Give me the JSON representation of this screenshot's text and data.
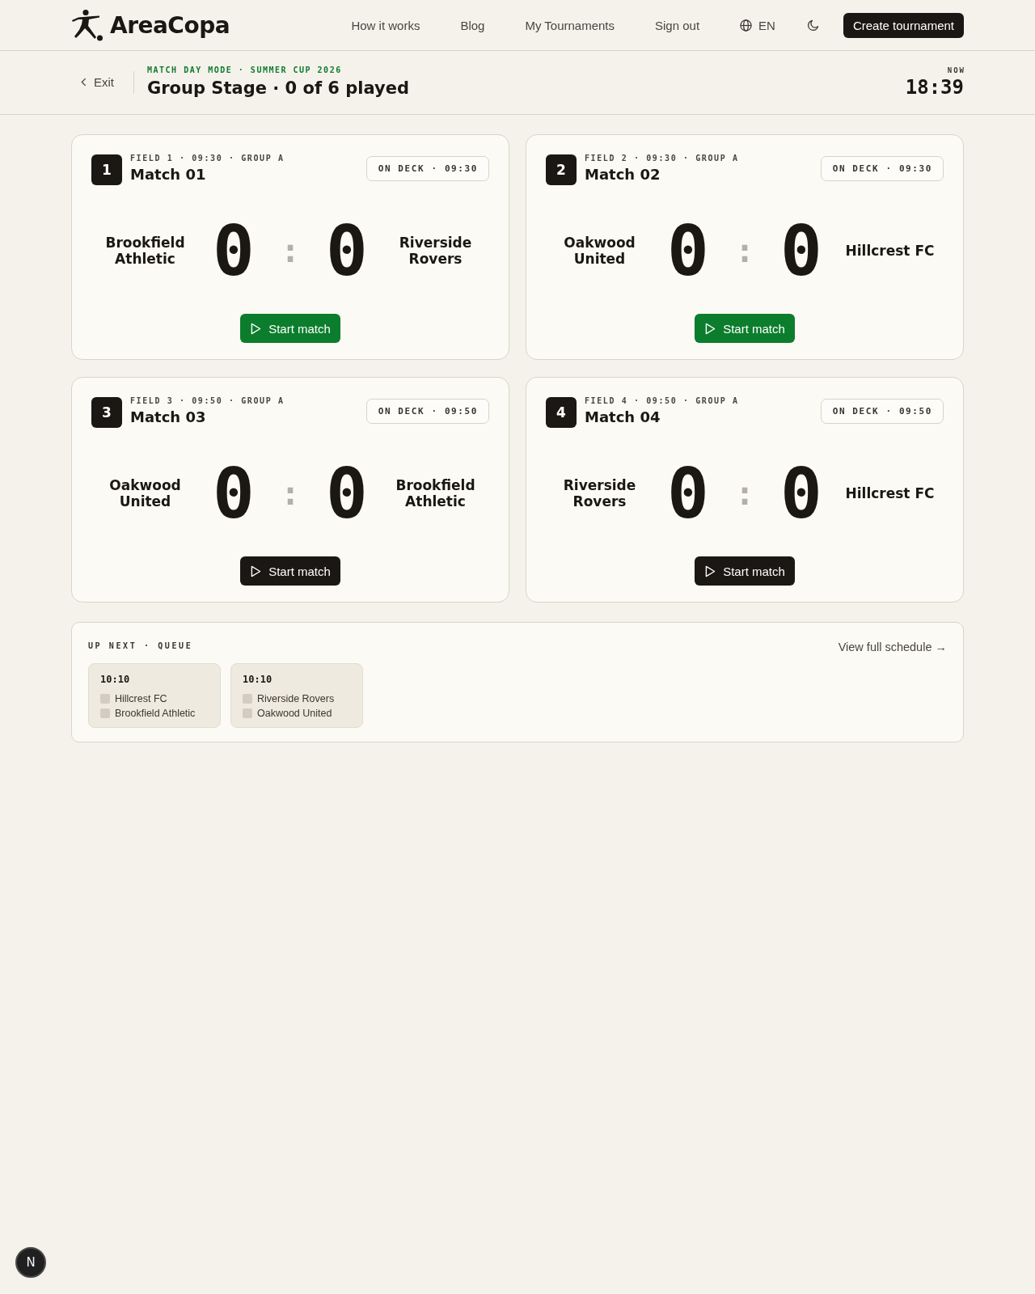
{
  "nav": {
    "brand": "AreaCopa",
    "links": [
      {
        "label": "How it works"
      },
      {
        "label": "Blog"
      },
      {
        "label": "My Tournaments"
      },
      {
        "label": "Sign out"
      }
    ],
    "language": "EN",
    "cta": "Create tournament"
  },
  "subheader": {
    "back": "Exit",
    "eyebrow": "MATCH DAY MODE · SUMMER CUP 2026",
    "title": "Group Stage · 0 of 6 played",
    "clock_label": "NOW",
    "clock": "18:39"
  },
  "matches": [
    {
      "number": "1",
      "meta": "FIELD 1 · 09:30 · GROUP A",
      "title": "Match 01",
      "status": "ON DECK · 09:30",
      "home": "Brookfield Athletic",
      "home_score": "0",
      "separator": ":",
      "away_score": "0",
      "away": "Riverside Rovers",
      "button": "Start match",
      "accent": true
    },
    {
      "number": "2",
      "meta": "FIELD 2 · 09:30 · GROUP A",
      "title": "Match 02",
      "status": "ON DECK · 09:30",
      "home": "Oakwood United",
      "home_score": "0",
      "separator": ":",
      "away_score": "0",
      "away": "Hillcrest FC",
      "button": "Start match",
      "accent": true
    },
    {
      "number": "3",
      "meta": "FIELD 3 · 09:50 · GROUP A",
      "title": "Match 03",
      "status": "ON DECK · 09:50",
      "home": "Oakwood United",
      "home_score": "0",
      "separator": ":",
      "away_score": "0",
      "away": "Brookfield Athletic",
      "button": "Start match",
      "accent": false
    },
    {
      "number": "4",
      "meta": "FIELD 4 · 09:50 · GROUP A",
      "title": "Match 04",
      "status": "ON DECK · 09:50",
      "home": "Riverside Rovers",
      "home_score": "0",
      "separator": ":",
      "away_score": "0",
      "away": "Hillcrest FC",
      "button": "Start match",
      "accent": false
    }
  ],
  "queue": {
    "title": "UP NEXT · QUEUE",
    "link": "View full schedule →",
    "items": [
      {
        "time": "10:10",
        "teams": [
          "Hillcrest FC",
          "Brookfield Athletic"
        ]
      },
      {
        "time": "10:10",
        "teams": [
          "Riverside Rovers",
          "Oakwood United"
        ]
      }
    ]
  },
  "dev_badge": {
    "label": "N"
  }
}
